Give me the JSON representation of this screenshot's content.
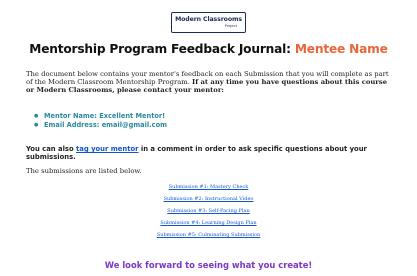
{
  "logo": {
    "line1": "Modern Classrooms",
    "line2": "Project"
  },
  "title": {
    "main": "Mentorship Program Feedback Journal: ",
    "mentee": "Mentee Name"
  },
  "intro": {
    "text": "The document below contains your mentor's feedback on each Submission that you will complete as part of the Modern Classroom Mentorship Program.",
    "bold": "If at any time you have questions about this course or Modern Classrooms, please contact your mentor:"
  },
  "mentor": {
    "name": "Mentor Name:  Excellent Mentor!",
    "email": "Email Address:  email@gmail.com"
  },
  "tag": {
    "before": "You can also ",
    "link": "tag your mentor",
    "after": " in a comment in order to ask specific questions about your submissions."
  },
  "submissions_intro": "The submissions are listed below.",
  "submissions": [
    "Submission #1: Mastery Check",
    "Submission #2: Instructional Video",
    "Submission #3: Self-Pacing Plan",
    "Submission #4: Learning Design Plan",
    "Submission #5: Culminating Submission"
  ],
  "closing": "We look forward to seeing what you create!",
  "colors": {
    "accent_orange": "#e8673a",
    "bullet_teal": "#2a8a9a",
    "link_blue": "#1155cc",
    "closing_purple": "#7a38c9",
    "logo_navy": "#1d2b56"
  }
}
